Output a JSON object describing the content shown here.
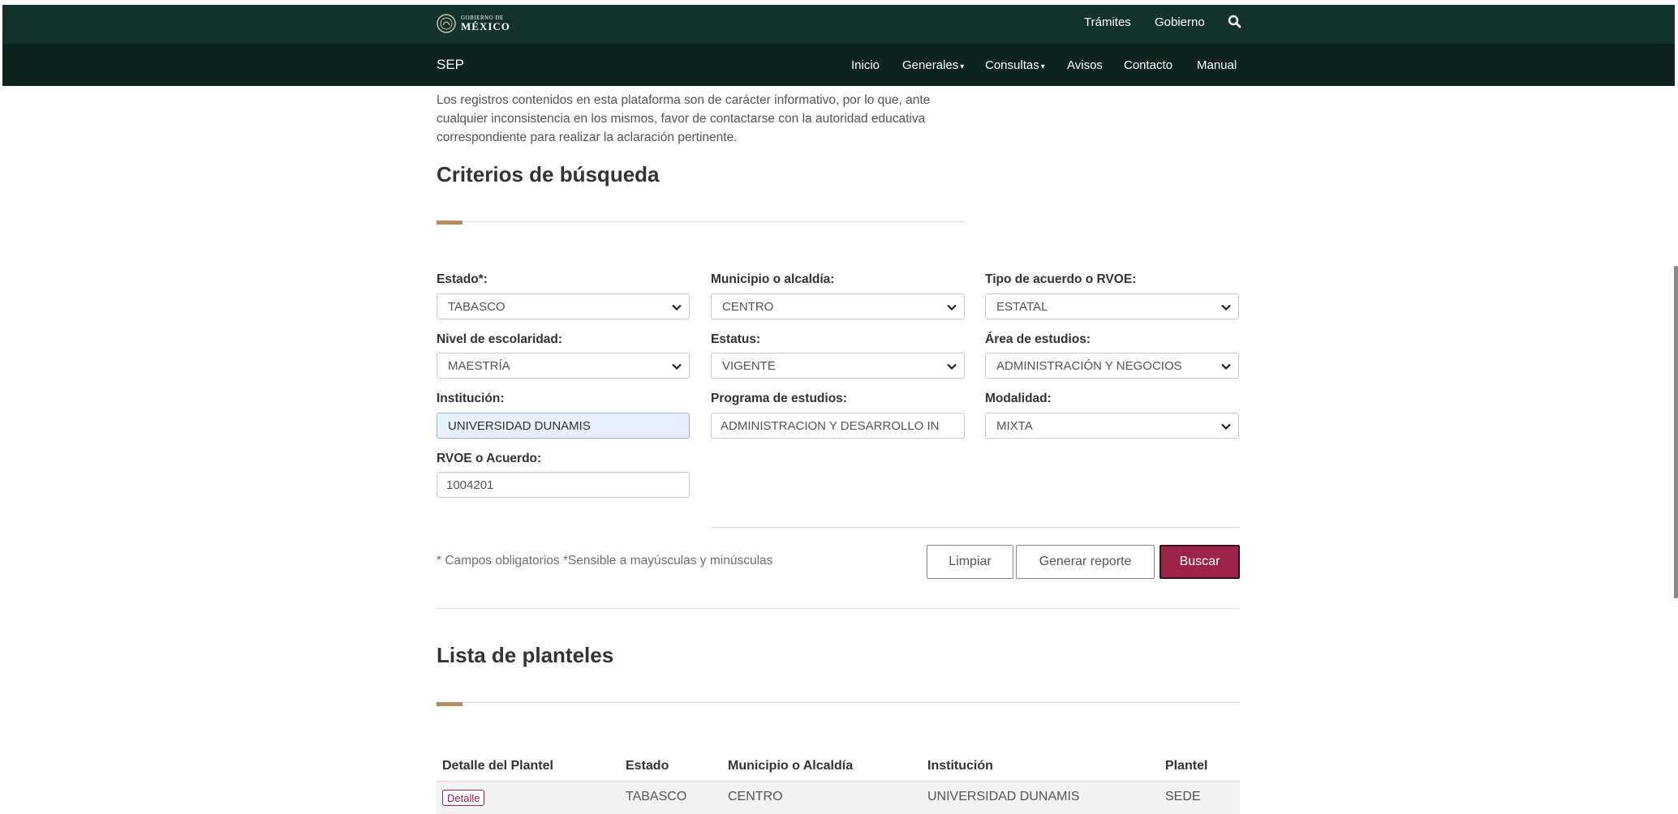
{
  "header": {
    "logo": {
      "line1": "GOBIERNO DE",
      "line2": "MÉXICO"
    },
    "links": [
      "Trámites",
      "Gobierno"
    ],
    "brand": "SEP",
    "nav": [
      "Inicio",
      "Generales",
      "Consultas",
      "Avisos",
      "Contacto",
      "Manual"
    ],
    "caret": "▾"
  },
  "intro": "Los registros contenidos en esta plataforma son de carácter informativo, por lo que, ante cualquier inconsistencia en los mismos, favor de contactarse con la autoridad educativa correspondiente para realizar la aclaración pertinente.",
  "search": {
    "title": "Criterios de búsqueda",
    "fields": {
      "estado": {
        "label": "Estado*:",
        "value": "TABASCO"
      },
      "municipio": {
        "label": "Municipio o alcaldía:",
        "value": "CENTRO"
      },
      "tipo": {
        "label": "Tipo de acuerdo o RVOE:",
        "value": "ESTATAL"
      },
      "nivel": {
        "label": "Nivel de escolaridad:",
        "value": "MAESTRÍA"
      },
      "estatus": {
        "label": "Estatus:",
        "value": "VIGENTE"
      },
      "area": {
        "label": "Área de estudios:",
        "value": "ADMINISTRACIÓN Y NEGOCIOS"
      },
      "institucion": {
        "label": "Institución:",
        "value": "UNIVERSIDAD DUNAMIS"
      },
      "programa": {
        "label": "Programa de estudios:",
        "value": "ADMINISTRACION Y DESARROLLO IN"
      },
      "modalidad": {
        "label": "Modalidad:",
        "value": "MIXTA"
      },
      "rvoe": {
        "label": "RVOE o Acuerdo:",
        "value": "1004201"
      }
    },
    "note": "* Campos obligatorios *Sensible a mayúsculas y minúsculas",
    "buttons": {
      "clear": "Limpiar",
      "report": "Generar reporte",
      "search": "Buscar"
    }
  },
  "results": {
    "title": "Lista de planteles",
    "columns": [
      "Detalle del Plantel",
      "Estado",
      "Municipio o Alcaldía",
      "Institución",
      "Plantel"
    ],
    "rows": [
      {
        "detail": "Detalle",
        "estado": "TABASCO",
        "municipio": "CENTRO",
        "institucion": "UNIVERSIDAD DUNAMIS",
        "plantel": "SEDE"
      }
    ]
  },
  "colors": {
    "header": "#13322b",
    "subheader": "#0c231e",
    "accent": "#b38e5d",
    "primary": "#9d2449"
  }
}
